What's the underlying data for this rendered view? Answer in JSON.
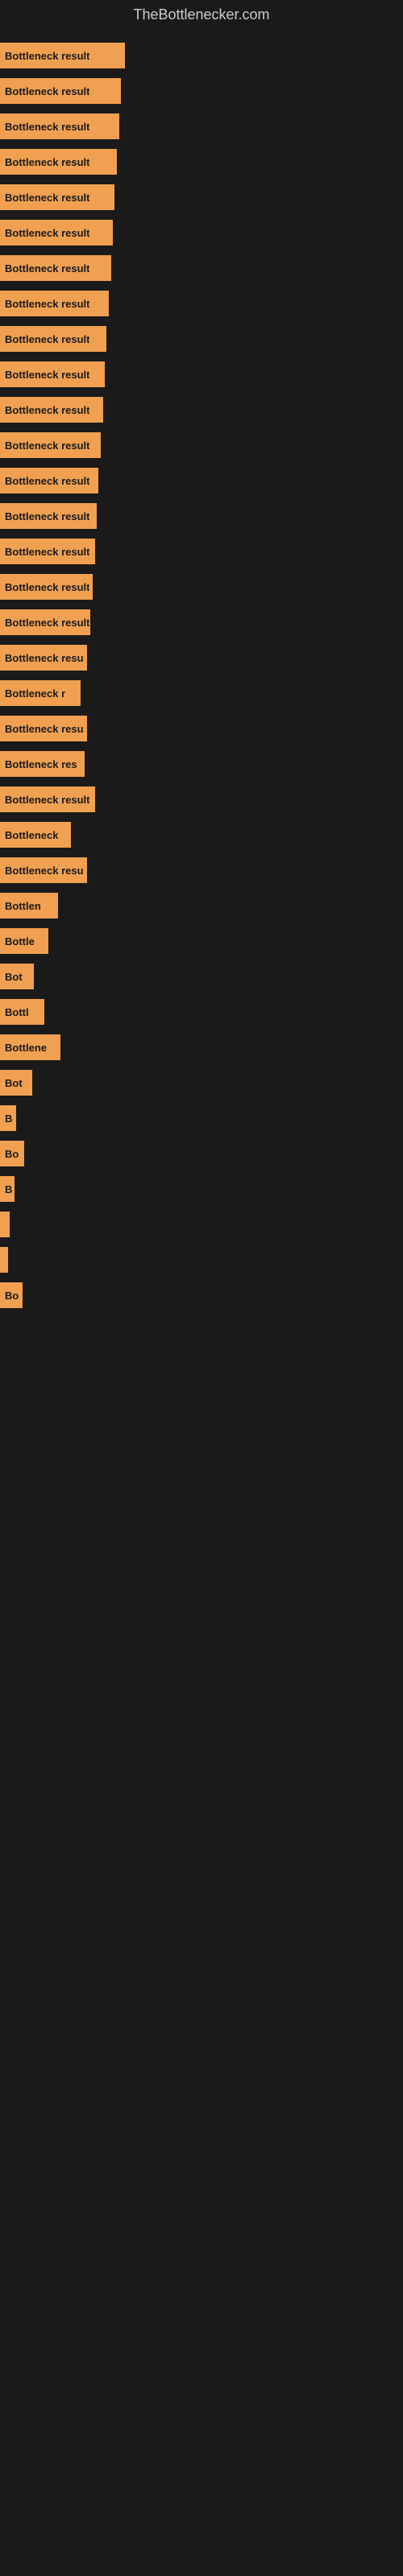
{
  "site_title": "TheBottlenecker.com",
  "bars": [
    {
      "label": "Bottleneck result",
      "width": 155
    },
    {
      "label": "Bottleneck result",
      "width": 150
    },
    {
      "label": "Bottleneck result",
      "width": 148
    },
    {
      "label": "Bottleneck result",
      "width": 145
    },
    {
      "label": "Bottleneck result",
      "width": 142
    },
    {
      "label": "Bottleneck result",
      "width": 140
    },
    {
      "label": "Bottleneck result",
      "width": 138
    },
    {
      "label": "Bottleneck result",
      "width": 135
    },
    {
      "label": "Bottleneck result",
      "width": 132
    },
    {
      "label": "Bottleneck result",
      "width": 130
    },
    {
      "label": "Bottleneck result",
      "width": 128
    },
    {
      "label": "Bottleneck result",
      "width": 125
    },
    {
      "label": "Bottleneck result",
      "width": 122
    },
    {
      "label": "Bottleneck result",
      "width": 120
    },
    {
      "label": "Bottleneck result",
      "width": 118
    },
    {
      "label": "Bottleneck result",
      "width": 115
    },
    {
      "label": "Bottleneck result",
      "width": 112
    },
    {
      "label": "Bottleneck resu",
      "width": 108
    },
    {
      "label": "Bottleneck r",
      "width": 100
    },
    {
      "label": "Bottleneck resu",
      "width": 108
    },
    {
      "label": "Bottleneck res",
      "width": 105
    },
    {
      "label": "Bottleneck result",
      "width": 118
    },
    {
      "label": "Bottleneck",
      "width": 88
    },
    {
      "label": "Bottleneck resu",
      "width": 108
    },
    {
      "label": "Bottlen",
      "width": 72
    },
    {
      "label": "Bottle",
      "width": 60
    },
    {
      "label": "Bot",
      "width": 42
    },
    {
      "label": "Bottl",
      "width": 55
    },
    {
      "label": "Bottlene",
      "width": 75
    },
    {
      "label": "Bot",
      "width": 40
    },
    {
      "label": "B",
      "width": 20
    },
    {
      "label": "Bo",
      "width": 30
    },
    {
      "label": "B",
      "width": 18
    },
    {
      "label": "",
      "width": 12
    },
    {
      "label": "",
      "width": 8
    },
    {
      "label": "Bo",
      "width": 28
    }
  ]
}
